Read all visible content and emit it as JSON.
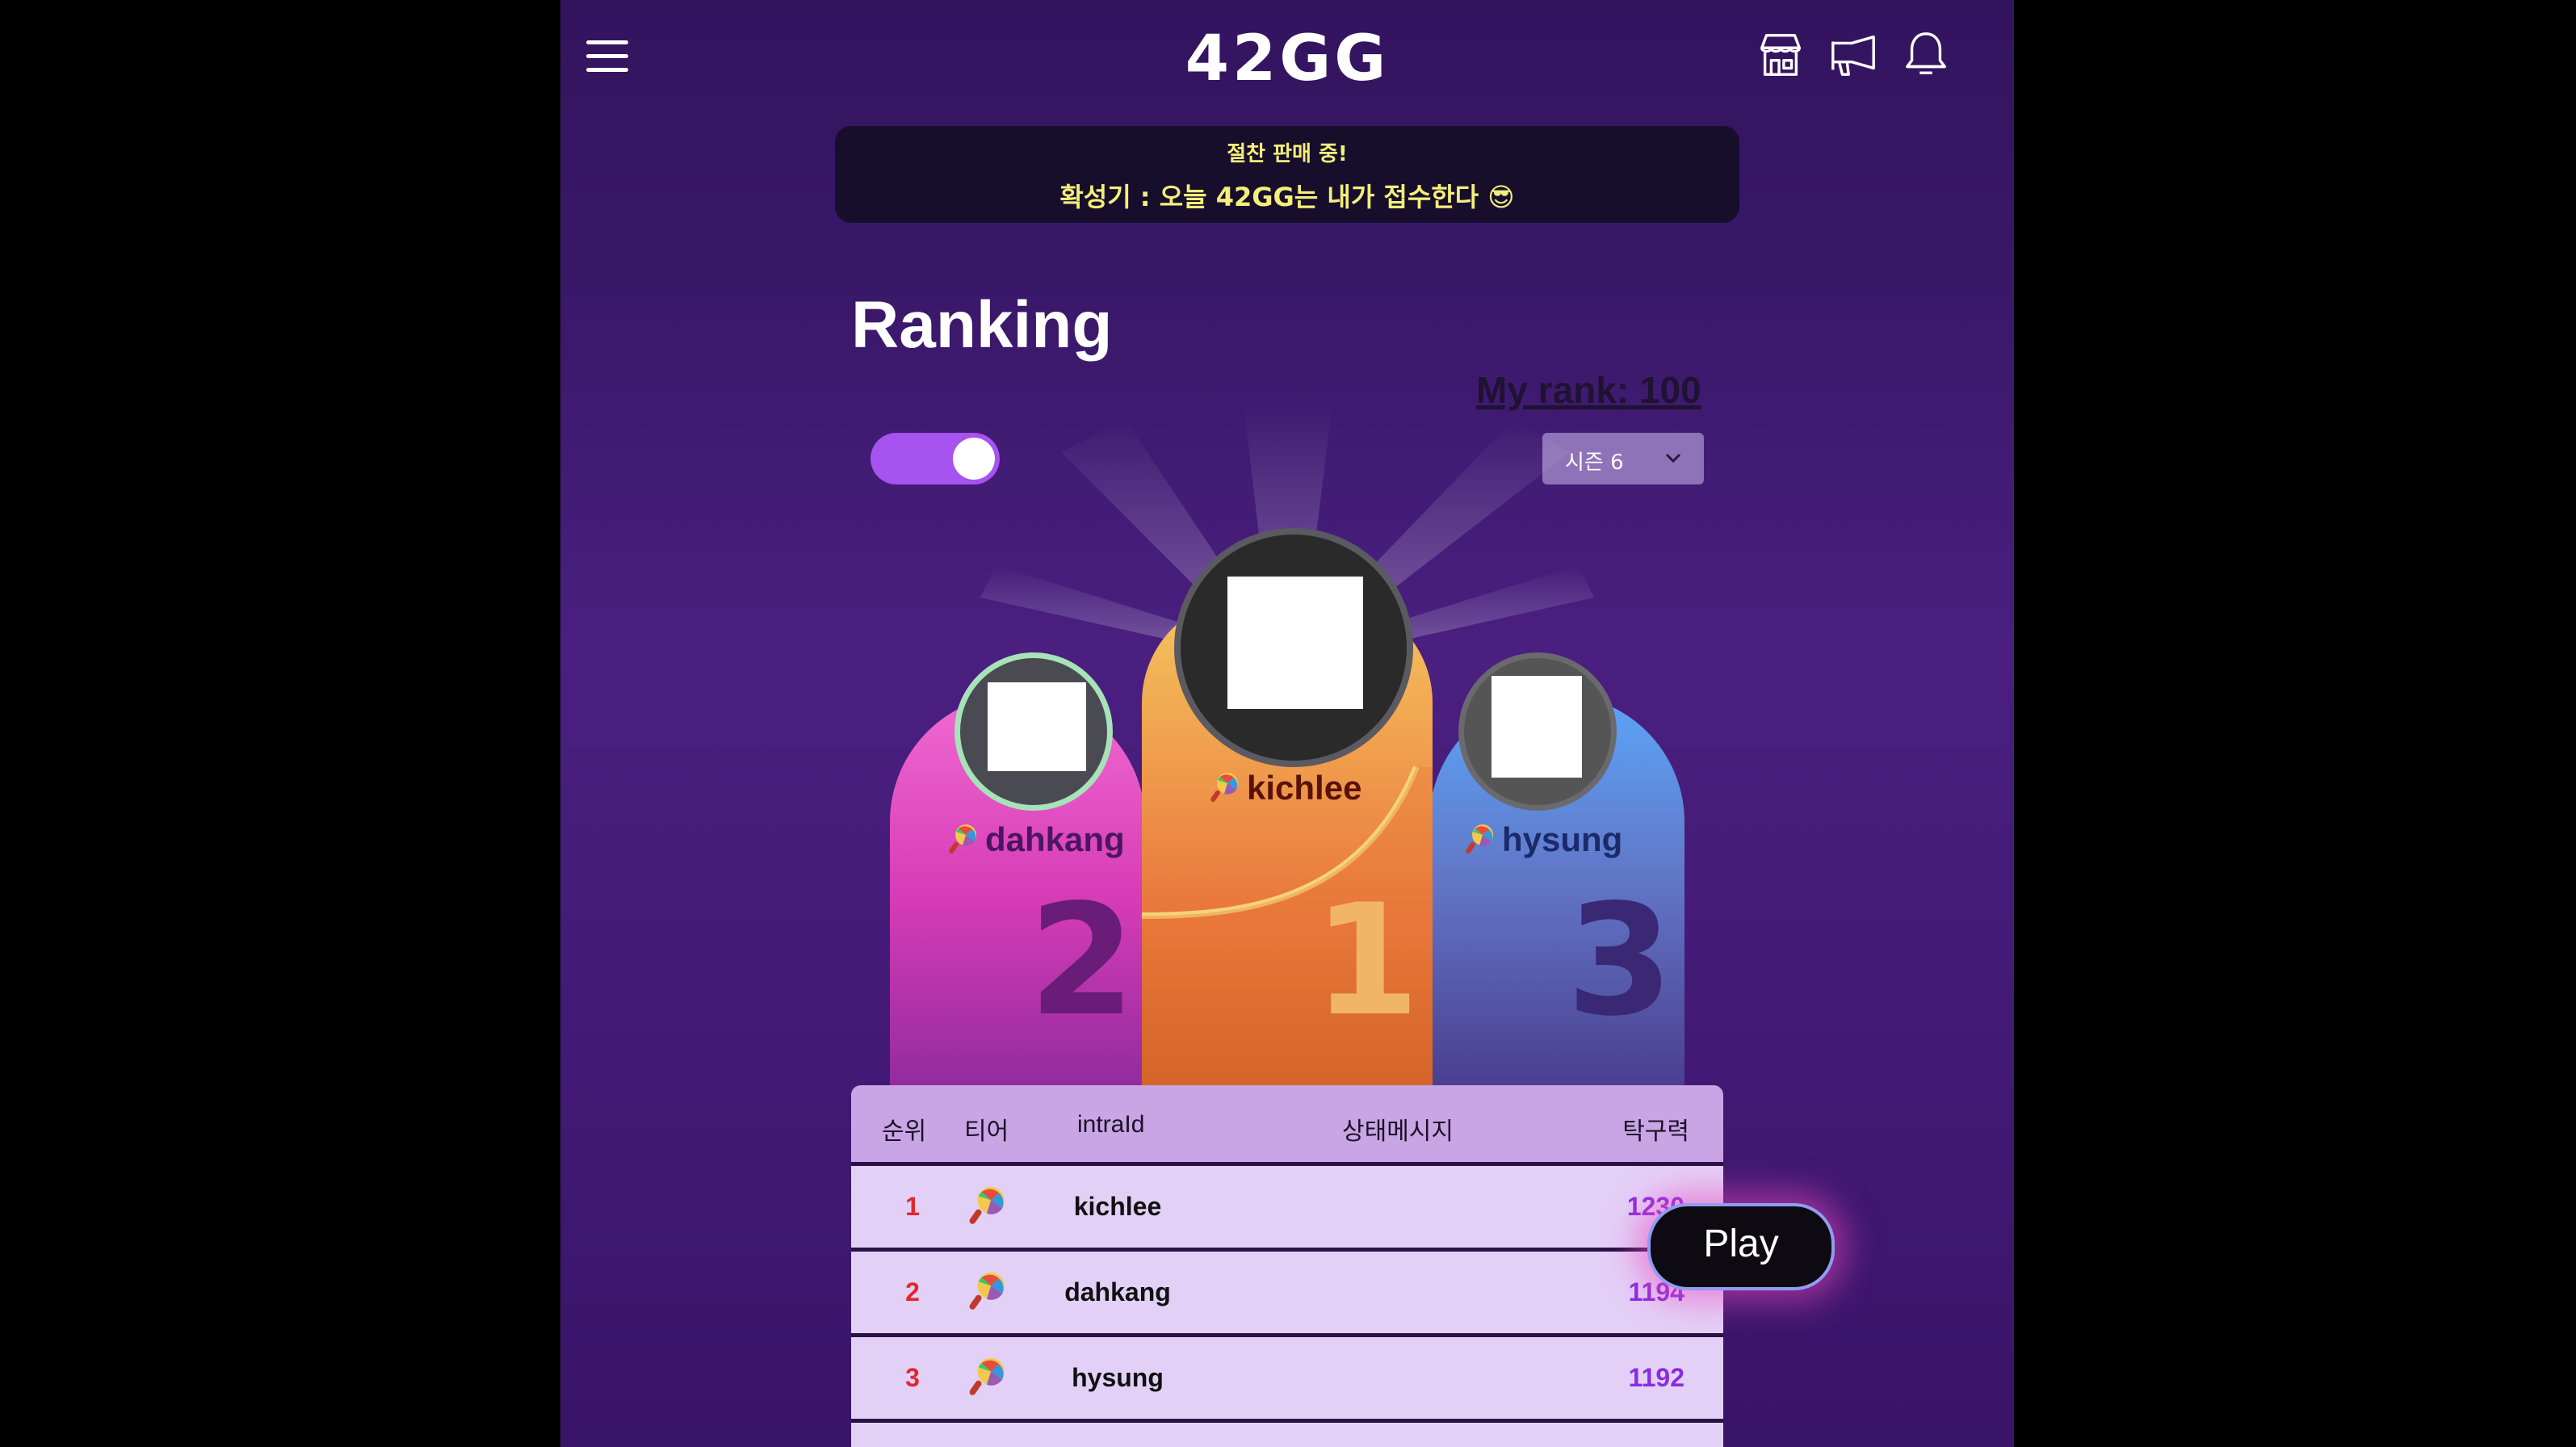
{
  "header": {
    "logo": "42GG",
    "icons": [
      "menu-icon",
      "store-icon",
      "megaphone-icon",
      "bell-icon"
    ]
  },
  "banner": {
    "title": "절찬 판매 중!",
    "message": "확성기 : 오늘 42GG는 내가 접수한다 😎"
  },
  "page": {
    "title": "Ranking",
    "my_rank": "My rank: 100",
    "toggle_on": true,
    "season_selected": "시즌 6"
  },
  "podium": [
    {
      "place": "1",
      "name": "kichlee"
    },
    {
      "place": "2",
      "name": "dahkang"
    },
    {
      "place": "3",
      "name": "hysung"
    }
  ],
  "table": {
    "headers": [
      "순위",
      "티어",
      "intraId",
      "상태메시지",
      "탁구력"
    ],
    "rows": [
      {
        "rank": "1",
        "intra_id": "kichlee",
        "ppp": "1230"
      },
      {
        "rank": "2",
        "intra_id": "dahkang",
        "ppp": "1194"
      },
      {
        "rank": "3",
        "intra_id": "hysung",
        "ppp": "1192"
      }
    ]
  },
  "play_button": "Play",
  "colors": {
    "accent": "#a653ef",
    "banner_text": "#f4ee7a",
    "rank_text": "#e0282c",
    "ppp_text": "#8a2ce0"
  }
}
